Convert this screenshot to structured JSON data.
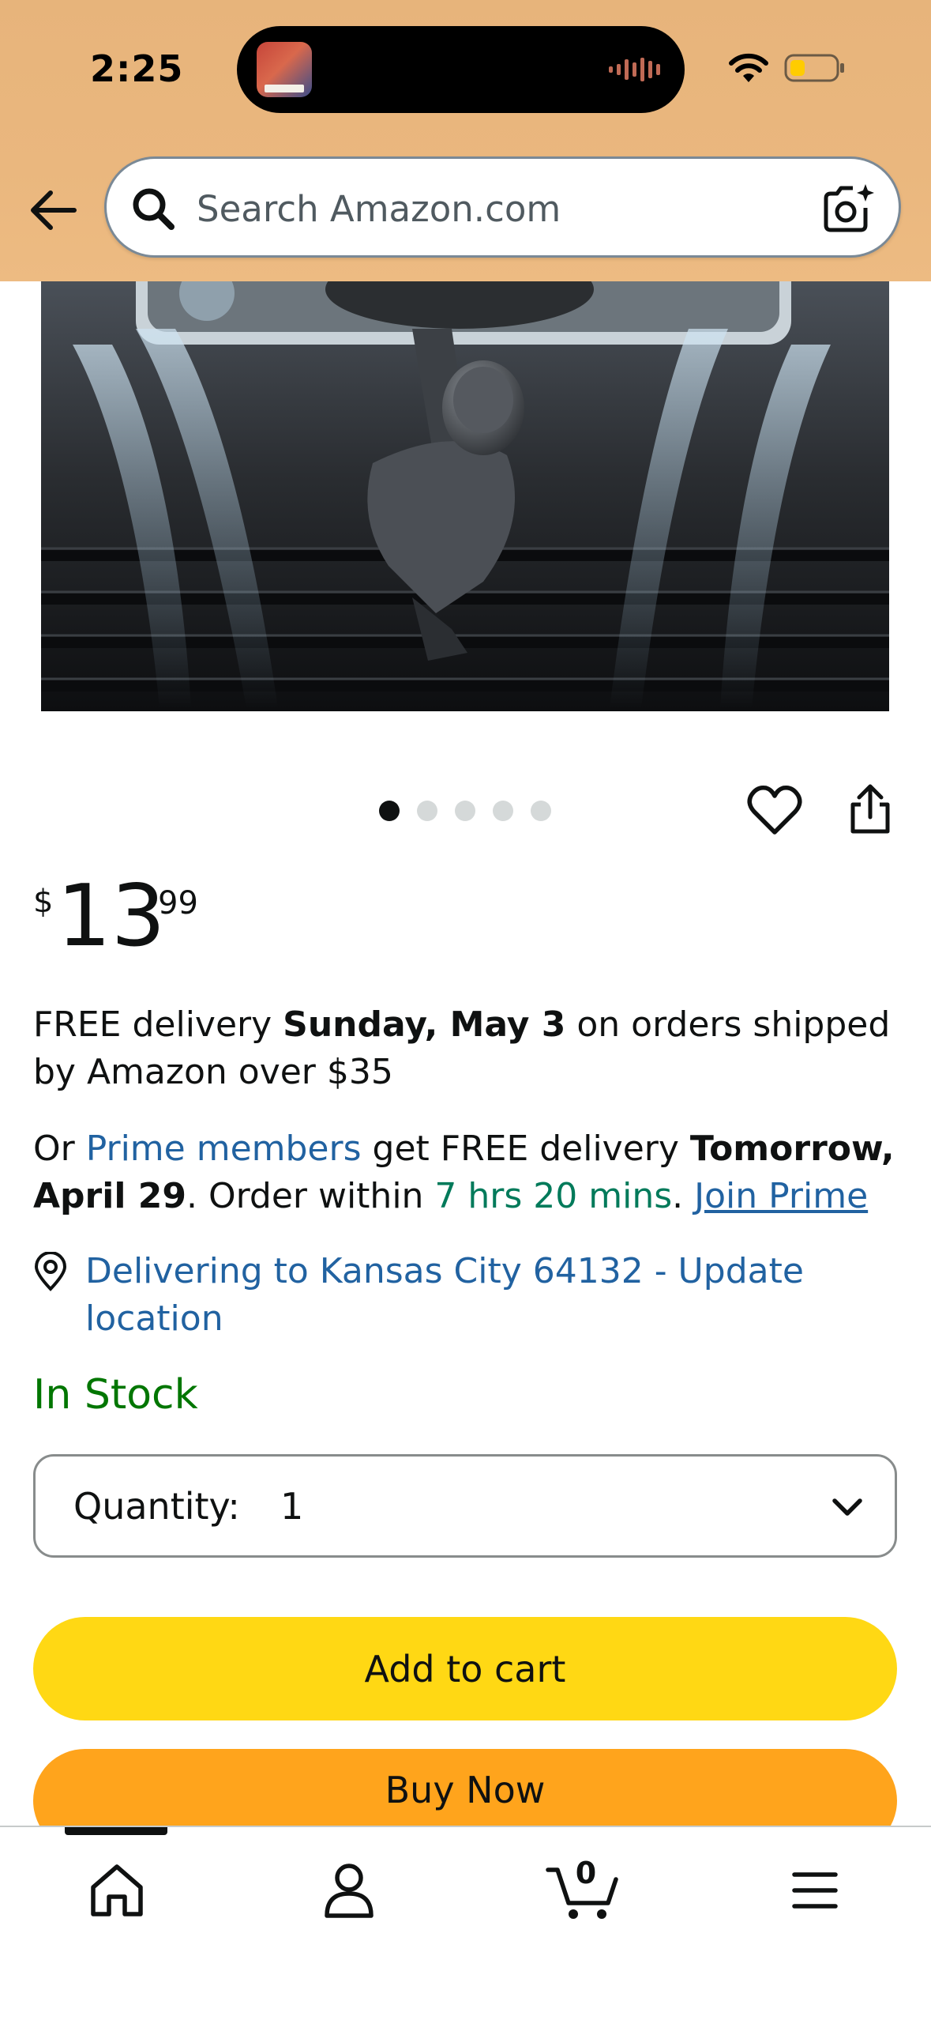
{
  "status_bar": {
    "time": "2:25"
  },
  "search": {
    "placeholder": "Search Amazon.com",
    "value": ""
  },
  "carousel": {
    "total": 5,
    "active_index": 0
  },
  "price": {
    "symbol": "$",
    "whole": "13",
    "fraction": "99"
  },
  "delivery": {
    "line1_prefix": "FREE delivery ",
    "line1_date": "Sunday, May 3",
    "line1_suffix": " on orders shipped by Amazon over $35",
    "prime_prefix": "Or ",
    "prime_link": "Prime members",
    "prime_mid": " get FREE delivery ",
    "prime_date": "Tomorrow, April 29",
    "prime_order": ". Order within ",
    "prime_countdown": "7 hrs 20 mins",
    "prime_period": ". ",
    "join_prime": "Join Prime"
  },
  "location": {
    "text": "Delivering to Kansas City 64132 - Update location"
  },
  "stock": {
    "status": "In Stock"
  },
  "quantity": {
    "label": "Quantity:",
    "value": "1"
  },
  "buttons": {
    "add_to_cart": "Add to cart",
    "buy_now": "Buy Now"
  },
  "bottom_nav": {
    "cart_count": "0",
    "active": "home"
  },
  "colors": {
    "header_bg": "#e9b77e",
    "add_to_cart": "#ffd814",
    "buy_now": "#ffa41c",
    "link": "#2162a1",
    "in_stock": "#007600",
    "countdown": "#007a5a"
  },
  "icons": [
    "back-arrow-icon",
    "search-icon",
    "camera-icon",
    "heart-icon",
    "share-icon",
    "location-pin-icon",
    "chevron-down-icon",
    "home-icon",
    "account-icon",
    "cart-icon",
    "menu-icon"
  ]
}
